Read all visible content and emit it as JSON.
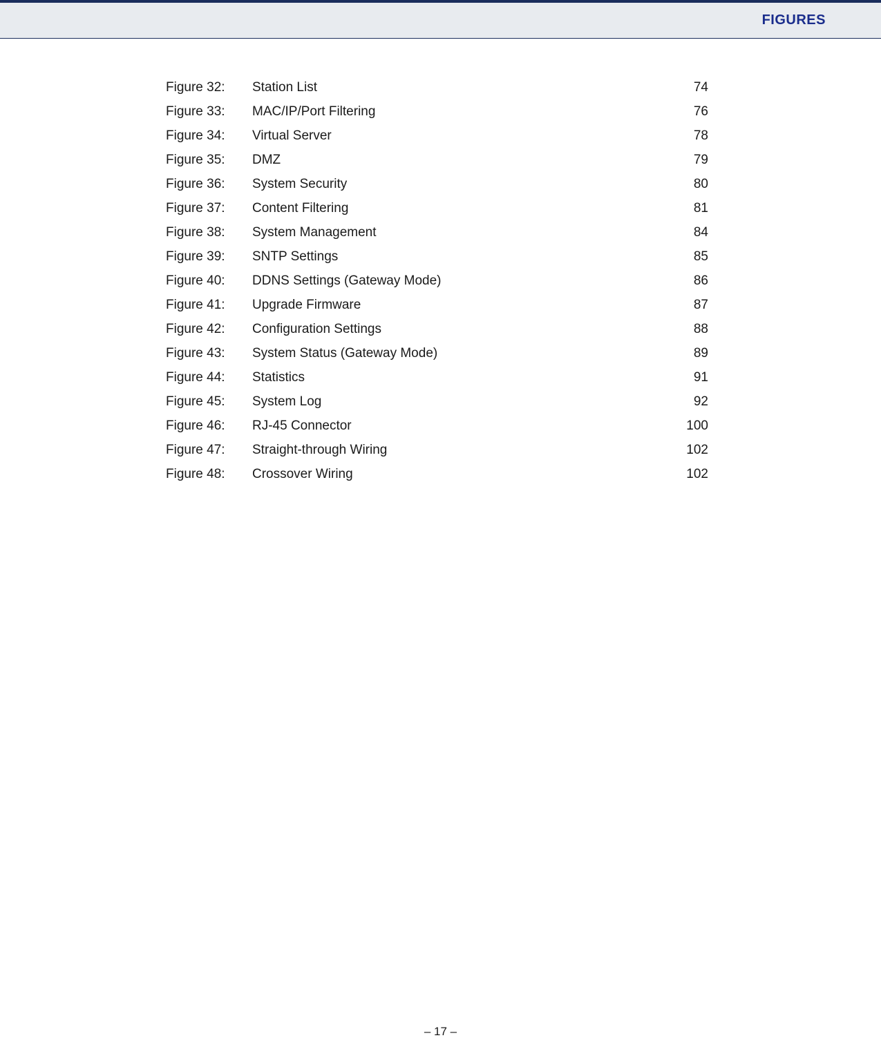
{
  "header": {
    "title": "FIGURES"
  },
  "figures": [
    {
      "label": "Figure 32:",
      "title": "Station List",
      "page": "74"
    },
    {
      "label": "Figure 33:",
      "title": "MAC/IP/Port Filtering",
      "page": "76"
    },
    {
      "label": "Figure 34:",
      "title": "Virtual Server",
      "page": "78"
    },
    {
      "label": "Figure 35:",
      "title": "DMZ",
      "page": "79"
    },
    {
      "label": "Figure 36:",
      "title": "System Security",
      "page": "80"
    },
    {
      "label": "Figure 37:",
      "title": "Content Filtering",
      "page": "81"
    },
    {
      "label": "Figure 38:",
      "title": "System Management",
      "page": "84"
    },
    {
      "label": "Figure 39:",
      "title": "SNTP Settings",
      "page": "85"
    },
    {
      "label": "Figure 40:",
      "title": "DDNS Settings (Gateway Mode)",
      "page": "86"
    },
    {
      "label": "Figure 41:",
      "title": "Upgrade Firmware",
      "page": "87"
    },
    {
      "label": "Figure 42:",
      "title": "Configuration Settings",
      "page": "88"
    },
    {
      "label": "Figure 43:",
      "title": "System Status (Gateway Mode)",
      "page": "89"
    },
    {
      "label": "Figure 44:",
      "title": "Statistics",
      "page": "91"
    },
    {
      "label": "Figure 45:",
      "title": "System Log",
      "page": "92"
    },
    {
      "label": "Figure 46:",
      "title": "RJ-45 Connector",
      "page": "100"
    },
    {
      "label": "Figure 47:",
      "title": "Straight-through Wiring",
      "page": "102"
    },
    {
      "label": "Figure 48:",
      "title": "Crossover Wiring",
      "page": "102"
    }
  ],
  "footer": {
    "page_display": "–  17  –"
  }
}
